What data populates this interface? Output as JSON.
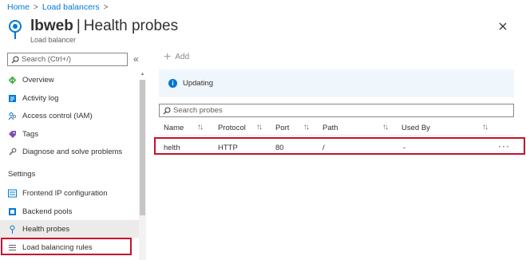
{
  "breadcrumb": {
    "home": "Home",
    "parent": "Load balancers",
    "sep": ">"
  },
  "header": {
    "resource_name": "lbweb",
    "separator": "|",
    "page": "Health probes",
    "subtitle": "Load balancer"
  },
  "sidebar": {
    "search_placeholder": "Search (Ctrl+/)",
    "collapse": "«",
    "items": [
      {
        "label": "Overview",
        "icon": "overview-icon"
      },
      {
        "label": "Activity log",
        "icon": "activity-log-icon"
      },
      {
        "label": "Access control (IAM)",
        "icon": "iam-icon"
      },
      {
        "label": "Tags",
        "icon": "tag-icon"
      },
      {
        "label": "Diagnose and solve problems",
        "icon": "wrench-icon"
      }
    ],
    "section_settings": "Settings",
    "settings_items": [
      {
        "label": "Frontend IP configuration",
        "icon": "frontend-ip-icon"
      },
      {
        "label": "Backend pools",
        "icon": "backend-pools-icon"
      },
      {
        "label": "Health probes",
        "icon": "health-probe-icon",
        "selected": true
      },
      {
        "label": "Load balancing rules",
        "icon": "rules-icon"
      }
    ]
  },
  "toolbar": {
    "add_label": "Add"
  },
  "banner": {
    "status": "Updating"
  },
  "probes": {
    "search_placeholder": "Search probes",
    "columns": [
      "Name",
      "Protocol",
      "Port",
      "Path",
      "Used By"
    ],
    "rows": [
      {
        "name": "helth",
        "protocol": "HTTP",
        "port": "80",
        "path": "/",
        "used_by": "-"
      }
    ]
  },
  "colors": {
    "accent": "#0078d4",
    "highlight": "#c8102e",
    "selected_bg": "#edebe9",
    "banner_bg": "#eff6fc"
  }
}
